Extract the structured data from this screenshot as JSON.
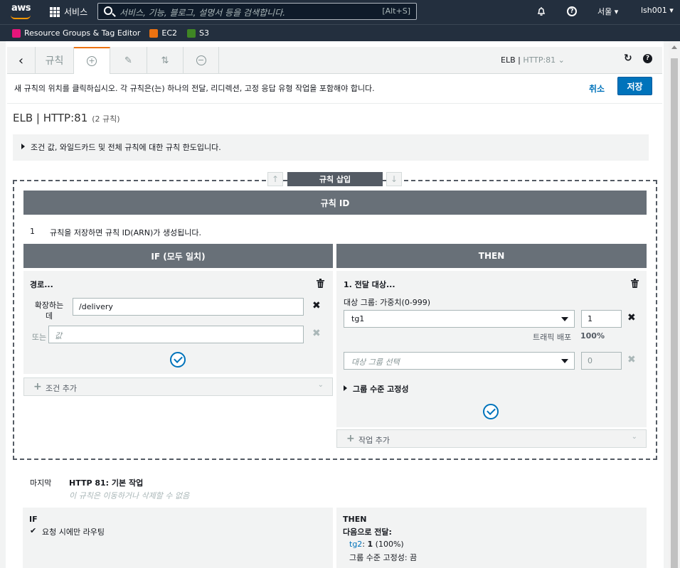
{
  "nav": {
    "services_label": "서비스",
    "search_placeholder": "서비스, 기능, 블로그, 설명서 등을 검색합니다.",
    "search_shortcut": "[Alt+S]",
    "region": "서울 ▾",
    "user": "lsh001 ▾"
  },
  "favorites": [
    {
      "label": "Resource Groups & Tag Editor",
      "color": "#e7157b"
    },
    {
      "label": "EC2",
      "color": "#ec7211"
    },
    {
      "label": "S3",
      "color": "#3f8624"
    }
  ],
  "toolbar": {
    "tab_rules": "규칙",
    "listener_prefix": "ELB | ",
    "listener_name": "HTTP:81 ⌄"
  },
  "message": "새 규칙의 위치를 클릭하십시오. 각 규칙은(는) 하나의 전달, 리디렉션, 고정 응답 유형 작업을 포함해야 합니다.",
  "actions": {
    "cancel": "취소",
    "save": "저장"
  },
  "page_title": "ELB | HTTP:81",
  "rule_count": "(2 규칙)",
  "limits_note": "조건 값, 와일드카드 및 전체 규칙에 대한 규칙 한도입니다.",
  "insert_rule": "규칙 삽입",
  "rule_id_header": "규칙 ID",
  "rule_number": "1",
  "rule_id_note": "규칙을 저장하면 규칙 ID(ARN)가 생성됩니다.",
  "if_header": "IF (모두 일치)",
  "then_header": "THEN",
  "condition": {
    "title": "경로...",
    "label_is": "확장하는 데",
    "value": "/delivery",
    "label_or": "또는",
    "placeholder": "값",
    "add": "조건 추가"
  },
  "action": {
    "title": "1. 전달 대상...",
    "target_label": "대상 그룹: 가중치(0-999)",
    "group1": "tg1",
    "weight1": "1",
    "traffic_label": "트래픽 배포",
    "traffic_value": "100%",
    "group2_placeholder": "대상 그룹 선택",
    "weight2": "0",
    "stickiness": "그룹 수준 고정성",
    "add": "작업 추가"
  },
  "last_rule": {
    "label": "마지막",
    "title": "HTTP 81: 기본 작업",
    "subtitle": "이 규칙은 이동하거나 삭제할 수 없음",
    "if_title": "IF",
    "if_text": "요청 시에만 라우팅",
    "then_title": "THEN",
    "forward_label": "다음으로 전달:",
    "target_name": "tg2",
    "target_sep": ": ",
    "target_weight": "1",
    "target_pct": " (100%)",
    "stickiness": "그룹 수준 고정성: 끔"
  }
}
